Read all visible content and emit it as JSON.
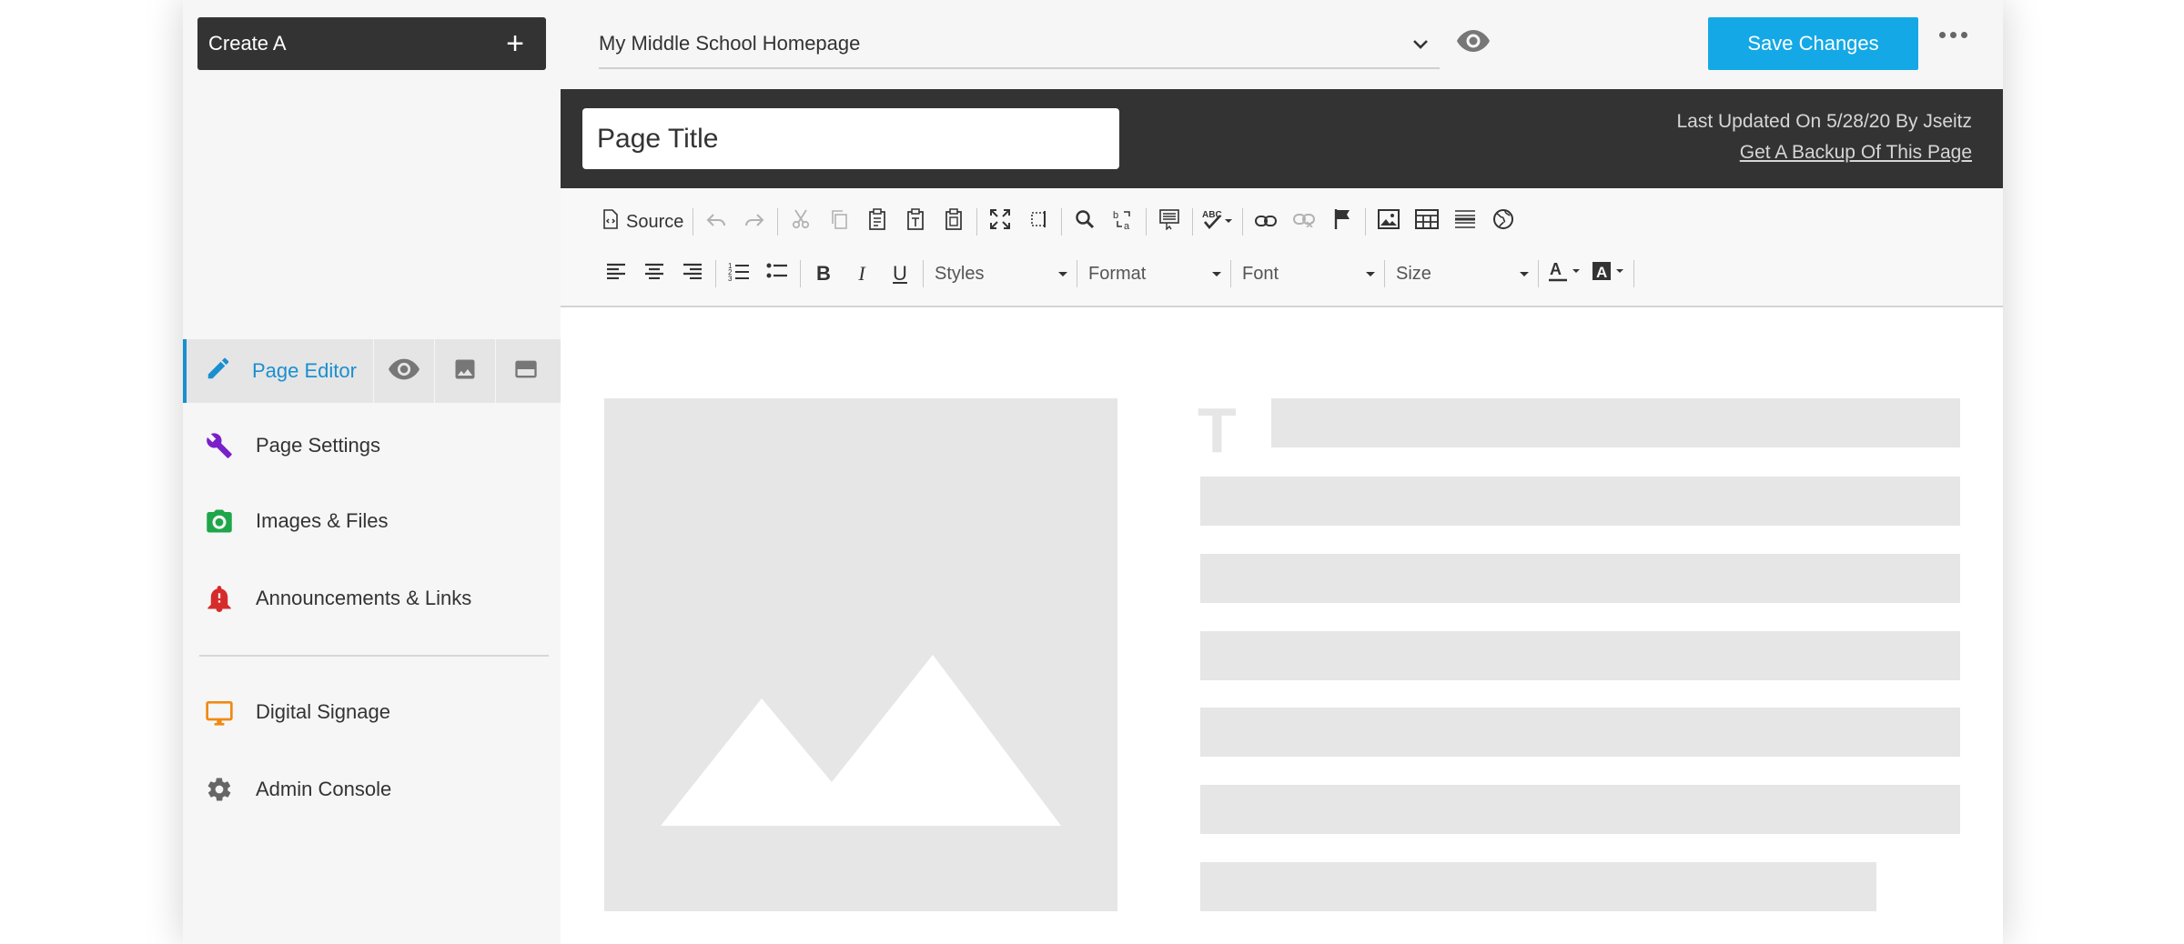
{
  "sidebar": {
    "create_label": "Create A",
    "nav_active": {
      "label": "Page Editor"
    },
    "nav_items": [
      {
        "label": "Page Settings",
        "icon": "wrench-icon",
        "color": "#7a1fc9"
      },
      {
        "label": "Images & Files",
        "icon": "camera-icon",
        "color": "#1fa64b"
      },
      {
        "label": "Announcements & Links",
        "icon": "bell-alert-icon",
        "color": "#d62b2b"
      },
      {
        "label": "Digital Signage",
        "icon": "monitor-icon",
        "color": "#f08a14"
      },
      {
        "label": "Admin Console",
        "icon": "gear-icon",
        "color": "#666666"
      }
    ]
  },
  "topbar": {
    "page_select": "My Middle School Homepage",
    "save_label": "Save Changes"
  },
  "titlebar": {
    "title_placeholder": "Page Title",
    "last_updated": "Last Updated On 5/28/20 By Jseitz",
    "backup_link": "Get A Backup Of This Page"
  },
  "toolbar": {
    "source_label": "Source",
    "styles_label": "Styles",
    "format_label": "Format",
    "font_label": "Font",
    "size_label": "Size"
  },
  "colors": {
    "accent": "#1a8fd0",
    "save": "#14a9e6",
    "dark": "#333333"
  }
}
